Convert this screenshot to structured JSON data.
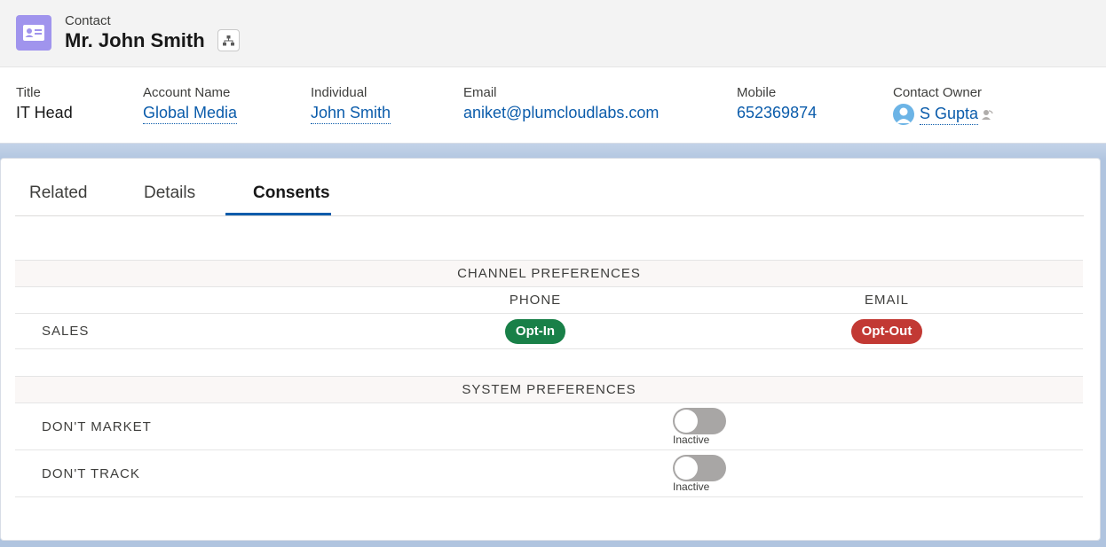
{
  "header": {
    "object_type": "Contact",
    "record_name": "Mr. John Smith",
    "icon": "contact-card-icon",
    "hierarchy_icon": "hierarchy-icon",
    "accent_color": "#a094ed"
  },
  "highlights": {
    "title": {
      "label": "Title",
      "value": "IT Head"
    },
    "account": {
      "label": "Account Name",
      "value": "Global Media"
    },
    "individual": {
      "label": "Individual",
      "value": "John Smith"
    },
    "email": {
      "label": "Email",
      "value": "aniket@plumcloudlabs.com"
    },
    "mobile": {
      "label": "Mobile",
      "value": "652369874"
    },
    "owner": {
      "label": "Contact Owner",
      "value": "S Gupta",
      "avatar_icon": "user-avatar-icon",
      "change_icon": "change-owner-icon"
    }
  },
  "tabs": [
    {
      "label": "Related"
    },
    {
      "label": "Details"
    },
    {
      "label": "Consents",
      "active": true
    }
  ],
  "channel_preferences": {
    "title": "CHANNEL PREFERENCES",
    "columns": [
      "PHONE",
      "EMAIL"
    ],
    "rows": [
      {
        "label": "SALES",
        "phone": "Opt-In",
        "email": "Opt-Out"
      }
    ],
    "colors": {
      "opt_in": "#198048",
      "opt_out": "#c23934"
    }
  },
  "system_preferences": {
    "title": "SYSTEM PREFERENCES",
    "rows": [
      {
        "label": "DON'T MARKET",
        "status": "Inactive"
      },
      {
        "label": "DON'T TRACK",
        "status": "Inactive"
      }
    ]
  }
}
